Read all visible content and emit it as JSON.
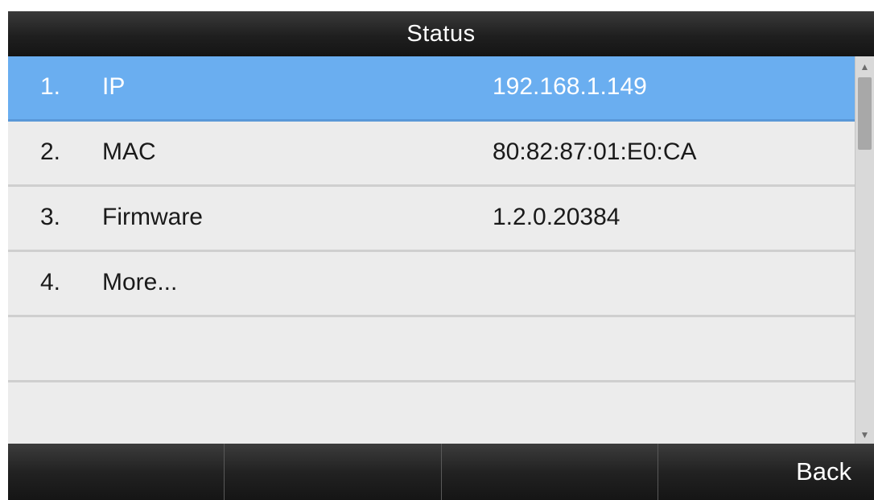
{
  "title": "Status",
  "items": [
    {
      "num": "1.",
      "label": "IP",
      "value": "192.168.1.149",
      "selected": true
    },
    {
      "num": "2.",
      "label": "MAC",
      "value": "80:82:87:01:E0:CA",
      "selected": false
    },
    {
      "num": "3.",
      "label": "Firmware",
      "value": "1.2.0.20384",
      "selected": false
    },
    {
      "num": "4.",
      "label": "More...",
      "value": "",
      "selected": false
    },
    {
      "num": "",
      "label": "",
      "value": "",
      "selected": false
    },
    {
      "num": "",
      "label": "",
      "value": "",
      "selected": false
    }
  ],
  "scrollbar": {
    "up_icon": "arrow-up-icon",
    "down_icon": "arrow-down-icon"
  },
  "softkeys": [
    "",
    "",
    "",
    "Back"
  ],
  "colors": {
    "selected": "#6aaef0",
    "titlebar": "#1f1f1f",
    "list_bg": "#ececec"
  }
}
